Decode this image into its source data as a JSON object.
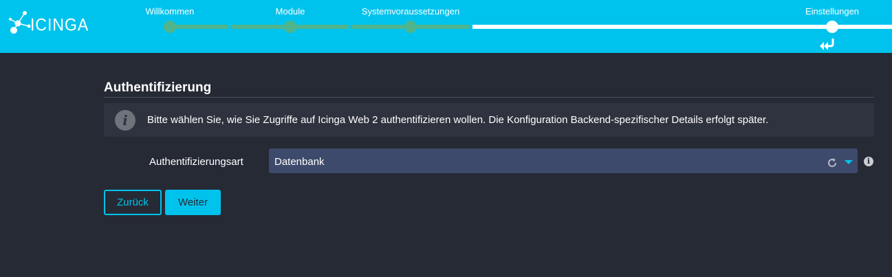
{
  "brand": {
    "logo_text": "ICINGA",
    "accent_color": "#00c3ed",
    "done_color": "#4fb58e"
  },
  "wizard": {
    "steps": [
      {
        "label": "Willkommen",
        "state": "done"
      },
      {
        "label": "Module",
        "state": "done"
      },
      {
        "label": "Systemvoraussetzungen",
        "state": "done"
      },
      {
        "label": "Einstellungen",
        "state": "current"
      }
    ],
    "return_icon": "double-return-arrow-icon"
  },
  "page": {
    "title": "Authentifizierung",
    "info_icon": "info-icon",
    "info_text": "Bitte wählen Sie, wie Sie Zugriffe auf Icinga Web 2 authentifizieren wollen. Die Konfiguration Backend-spezifischer Details erfolgt später."
  },
  "form": {
    "auth_type_label": "Authentifizierungsart",
    "auth_type_value": "Datenbank",
    "help_icon": "help-icon"
  },
  "buttons": {
    "back_label": "Zurück",
    "next_label": "Weiter"
  }
}
